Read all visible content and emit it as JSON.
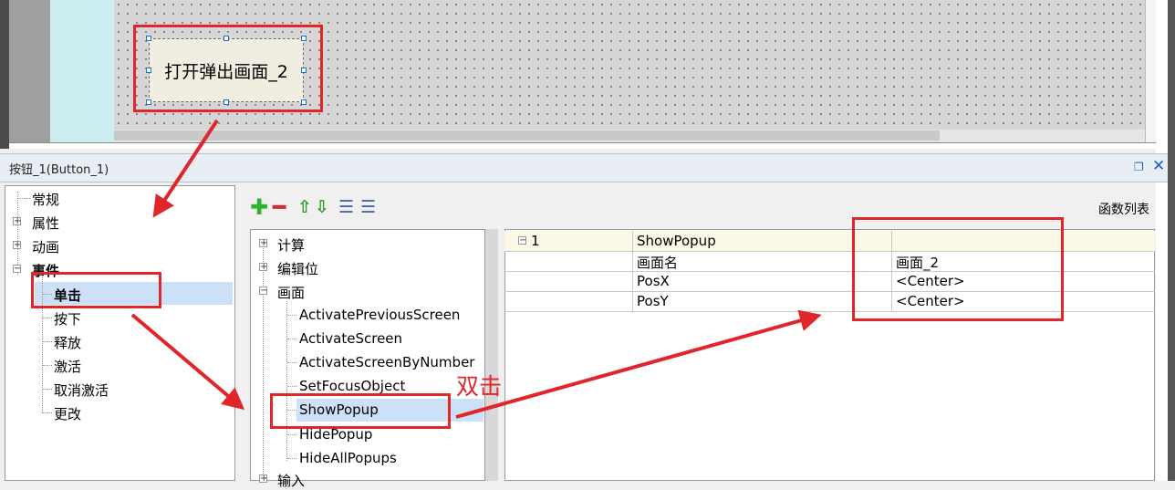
{
  "canvas": {
    "button_object_label": "打开弹出画面_2"
  },
  "properties_panel": {
    "title": "按钮_1(Button_1)",
    "float_icon": "restore-window-icon",
    "close_icon": "close-x-icon",
    "tree": [
      {
        "label": "常规",
        "expander": ""
      },
      {
        "label": "属性",
        "expander": "+"
      },
      {
        "label": "动画",
        "expander": "+"
      },
      {
        "label": "事件",
        "expander": "−"
      },
      {
        "label": "单击",
        "expander": "",
        "selected": true
      },
      {
        "label": "按下",
        "expander": ""
      },
      {
        "label": "释放",
        "expander": ""
      },
      {
        "label": "激活",
        "expander": ""
      },
      {
        "label": "取消激活",
        "expander": ""
      },
      {
        "label": "更改",
        "expander": ""
      }
    ]
  },
  "toolbar": {
    "add_icon": "plus-icon",
    "remove_icon": "minus-icon",
    "up_icon": "arrow-up-icon",
    "down_icon": "arrow-down-icon",
    "indent_icon": "indent-icon",
    "outdent_icon": "outdent-icon",
    "function_list_label": "函数列表",
    "add_color": "#2fb32f",
    "remove_color": "#e0262b"
  },
  "function_tree": [
    {
      "label": "计算",
      "expander": "+"
    },
    {
      "label": "编辑位",
      "expander": "+"
    },
    {
      "label": "画面",
      "expander": "−"
    },
    {
      "label": "ActivatePreviousScreen",
      "expander": ""
    },
    {
      "label": "ActivateScreen",
      "expander": ""
    },
    {
      "label": "ActivateScreenByNumber",
      "expander": ""
    },
    {
      "label": "SetFocusObject",
      "expander": ""
    },
    {
      "label": "ShowPopup",
      "expander": "",
      "selected": true
    },
    {
      "label": "HidePopup",
      "expander": ""
    },
    {
      "label": "HideAllPopups",
      "expander": ""
    },
    {
      "label": "输入",
      "expander": "+"
    }
  ],
  "function_table": {
    "rows": [
      {
        "index": "1",
        "expander": "−",
        "name": "ShowPopup",
        "value": ""
      },
      {
        "index": "",
        "expander": "",
        "name": "画面名",
        "value": "画面_2"
      },
      {
        "index": "",
        "expander": "",
        "name": "PosX",
        "value": "<Center>"
      },
      {
        "index": "",
        "expander": "",
        "name": "PosY",
        "value": "<Center>"
      }
    ]
  },
  "annotations": {
    "double_click_label": "双击",
    "highlight_color": "#e0262b"
  }
}
